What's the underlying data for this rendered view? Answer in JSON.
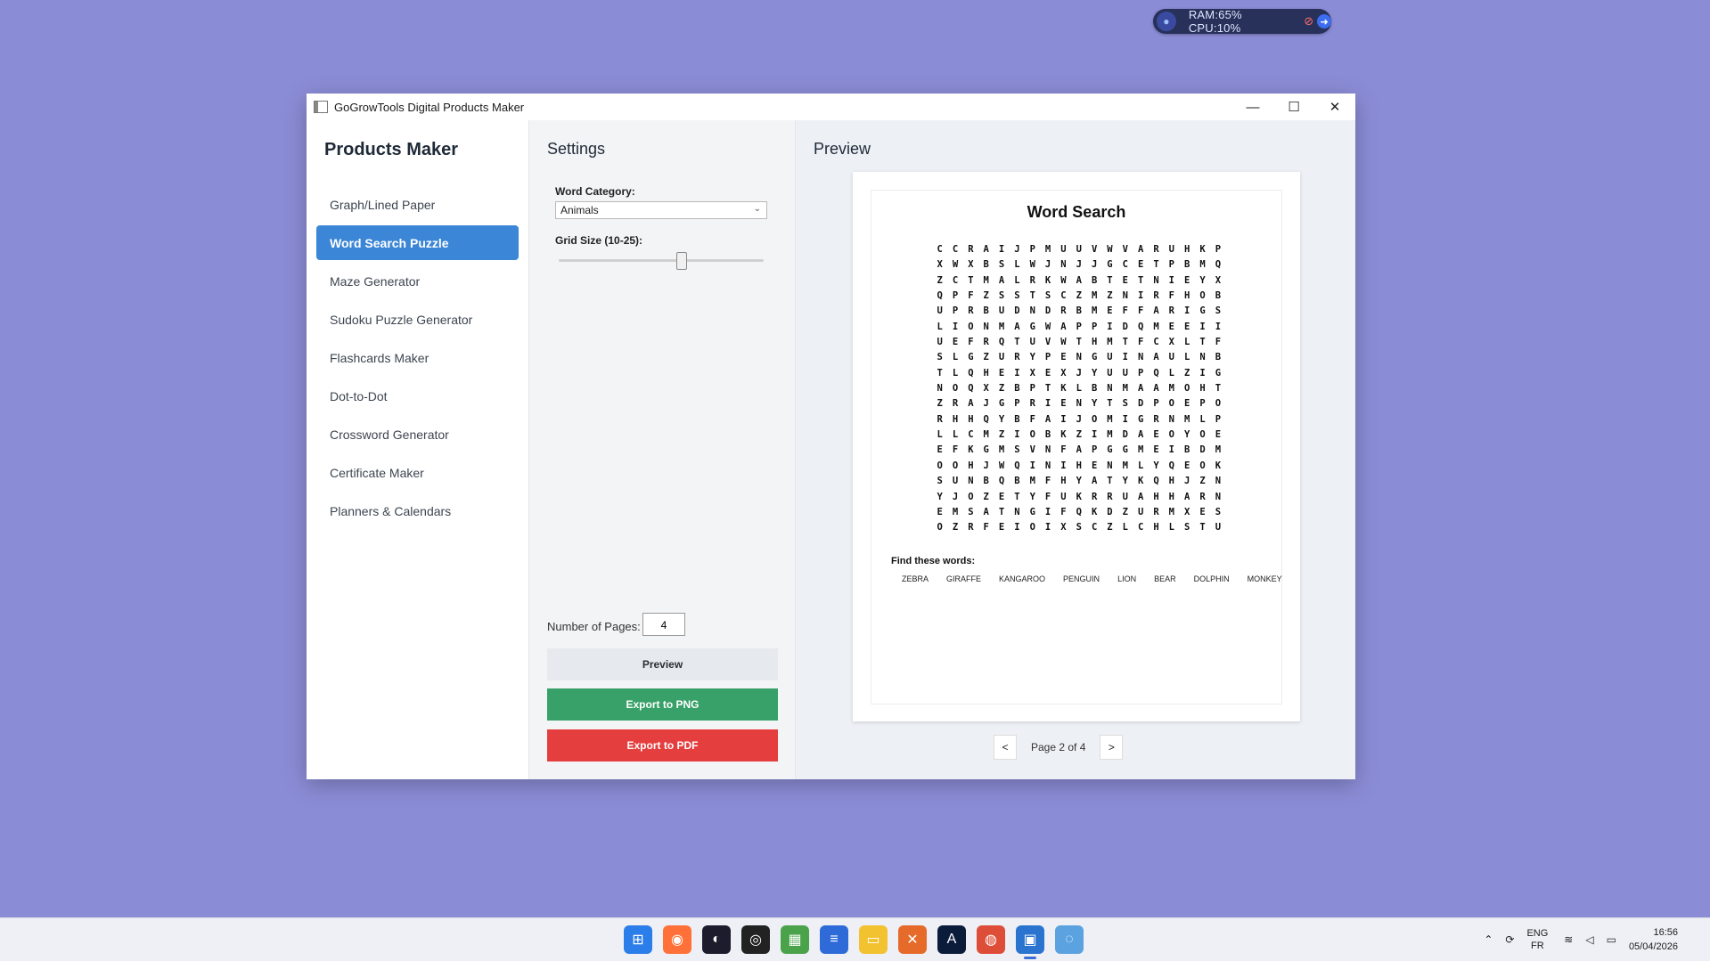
{
  "perf_widget": {
    "text": "RAM:65%  CPU:10%"
  },
  "window": {
    "title": "GoGrowTools Digital Products Maker",
    "minimize": "—",
    "maximize": "☐",
    "close": "✕"
  },
  "sidebar": {
    "title": "Products Maker",
    "items": [
      {
        "label": "Graph/Lined Paper",
        "active": false
      },
      {
        "label": "Word Search Puzzle",
        "active": true
      },
      {
        "label": "Maze Generator",
        "active": false
      },
      {
        "label": "Sudoku Puzzle Generator",
        "active": false
      },
      {
        "label": "Flashcards Maker",
        "active": false
      },
      {
        "label": "Dot-to-Dot",
        "active": false
      },
      {
        "label": "Crossword Generator",
        "active": false
      },
      {
        "label": "Certificate Maker",
        "active": false
      },
      {
        "label": "Planners & Calendars",
        "active": false
      }
    ]
  },
  "settings": {
    "title": "Settings",
    "category_label": "Word Category:",
    "category_value": "Animals",
    "grid_size_label": "Grid Size (10-25):",
    "grid_size_value": 19,
    "pages_label": "Number of Pages:",
    "pages_value": "4",
    "preview_button": "Preview",
    "export_png_button": "Export to PNG",
    "export_pdf_button": "Export to PDF"
  },
  "preview": {
    "title": "Preview",
    "puzzle_title": "Word Search",
    "grid": [
      "CCRAIJPMUUVWVARUHKP",
      "XWXBSLWJNJJGCETPBMQ",
      "ZCTMALRKWABTETNIEYX",
      "QPFZSSTSCZMZNIRFHOB",
      "UPRBUDNDRBMEFFARIGS",
      "LIONMAGWAPPIDQMEEII",
      "UEFRQTUVWTHMTFCXLTF",
      "SLGZURYPENGUINAULNB",
      "TLQHEIXEXJYUUPQLZIG",
      "NOQXZBPTKLBNMAAMOHT",
      "ZRAJGPRIENYTSDPOEPO",
      "RHHQYBFAIJOMIGRNMLP",
      "LLCMZIOBKZIMDAEOYOE",
      "EFKGMSVNFAPGGMEIBDM",
      "OOHJWQINIHENMLYQEOK",
      "SUNBQBMFHYATYKQHJZN",
      "YJOZETYFUKRRUAHHARN",
      "EMSATNGIFQKDZURMXES",
      "OZRFEIOIXSCZLCHLSTU"
    ],
    "find_label": "Find these words:",
    "words": [
      "ZEBRA",
      "GIRAFFE",
      "KANGAROO",
      "PENGUIN",
      "LION",
      "BEAR",
      "DOLPHIN",
      "MONKEY"
    ],
    "pager": {
      "prev": "<",
      "next": ">",
      "text": "Page 2 of 4"
    }
  },
  "taskbar": {
    "tray": {
      "lang_top": "ENG",
      "lang_bottom": "FR",
      "time": "16:56",
      "date": "05/04/2026"
    }
  }
}
